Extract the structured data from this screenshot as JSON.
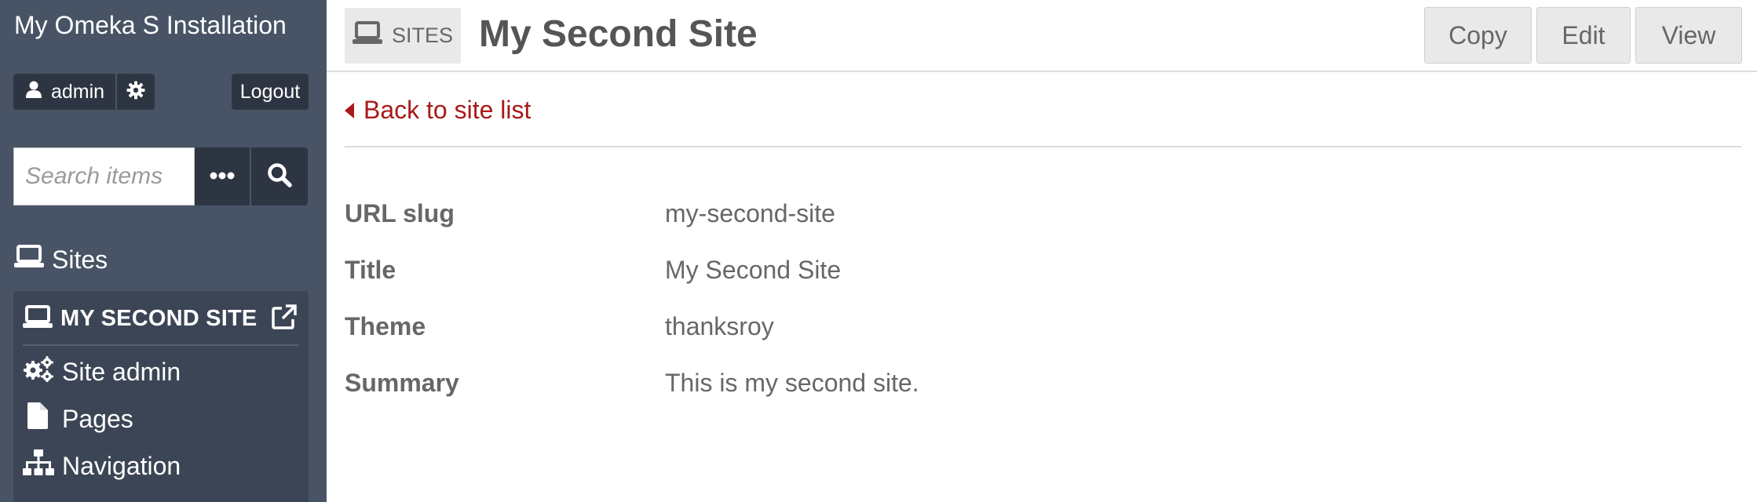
{
  "sidebar": {
    "install_title": "My Omeka S Installation",
    "user": {
      "name": "admin",
      "icon": "user-icon"
    },
    "settings_icon": "gear-icon",
    "logout_label": "Logout",
    "search": {
      "placeholder": "Search items",
      "advanced_icon": "ellipsis-icon",
      "submit_icon": "search-icon"
    },
    "sites_header": {
      "label": "Sites",
      "icon": "laptop-icon"
    },
    "current_site": {
      "name": "MY SECOND SITE",
      "icon": "laptop-icon",
      "external_icon": "external-link-icon",
      "nav": [
        {
          "label": "Site admin",
          "icon": "cogs-icon"
        },
        {
          "label": "Pages",
          "icon": "file-icon"
        },
        {
          "label": "Navigation",
          "icon": "sitemap-icon"
        }
      ]
    }
  },
  "header": {
    "section_label": "SITES",
    "section_icon": "laptop-icon",
    "title": "My Second Site",
    "actions": [
      "Copy",
      "Edit",
      "View"
    ]
  },
  "main": {
    "back_link": "Back to site list",
    "properties": [
      {
        "label": "URL slug",
        "value": "my-second-site"
      },
      {
        "label": "Title",
        "value": "My Second Site"
      },
      {
        "label": "Theme",
        "value": "thanksroy"
      },
      {
        "label": "Summary",
        "value": "This is my second site."
      }
    ]
  },
  "colors": {
    "sidebar_bg": "#485466",
    "sidebar_dark": "#2e3542",
    "site_panel_bg": "#3b4555",
    "link_red": "#a91919",
    "text_gray": "#676767"
  }
}
